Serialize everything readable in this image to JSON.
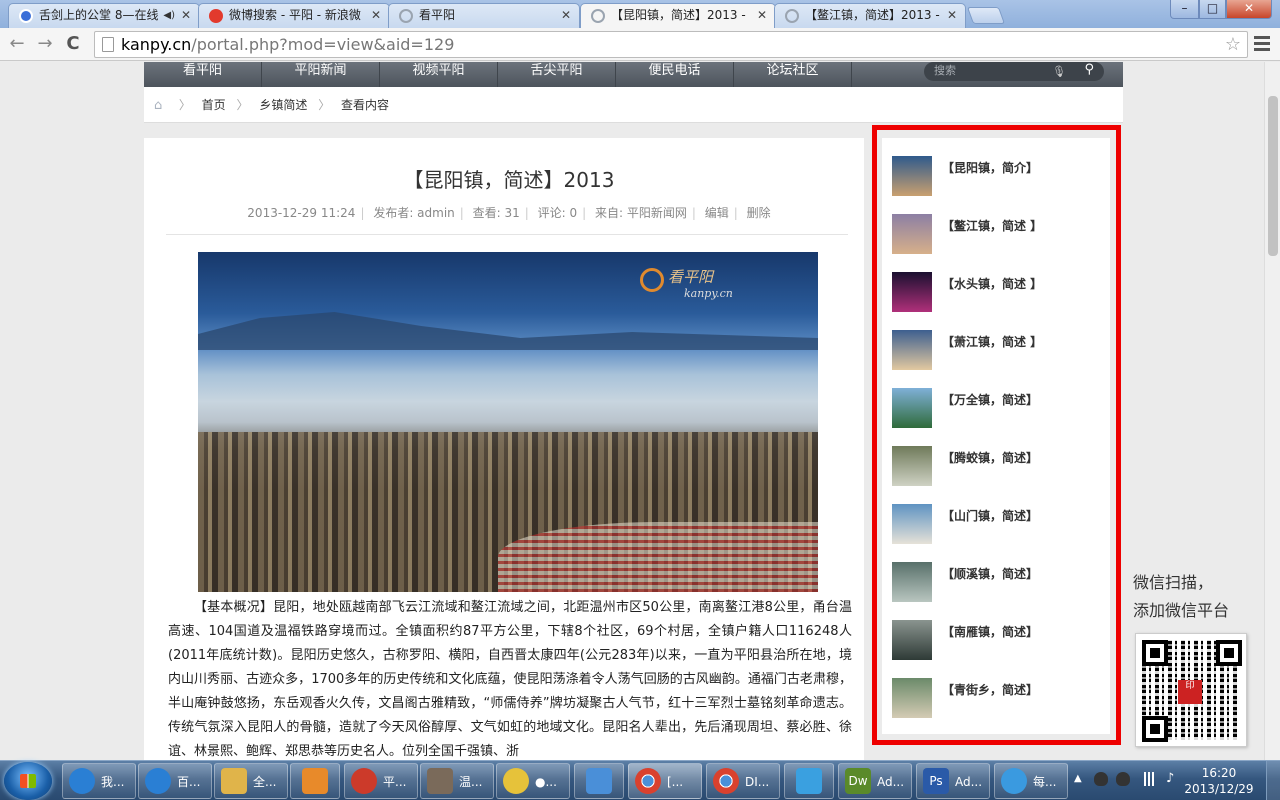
{
  "browser": {
    "tabs": [
      {
        "title": "舌剑上的公堂 8—在线",
        "favicon_color": "#3b6fd8",
        "has_sound": true
      },
      {
        "title": "微博搜索 - 平阳 - 新浪微",
        "favicon_color": "#e23a2d"
      },
      {
        "title": "看平阳",
        "favicon_color": "#9aa4b0"
      },
      {
        "title": "【昆阳镇，简述】2013 -",
        "favicon_color": "#9aa4b0",
        "active": true
      },
      {
        "title": "【鳌江镇，简述】2013 -",
        "favicon_color": "#9aa4b0"
      }
    ],
    "window_controls": {
      "min": "–",
      "max": "□",
      "close": "✕"
    },
    "url_domain": "kanpy.cn",
    "url_path": "/portal.php?mod=view&aid=129",
    "back": "←",
    "forward": "→",
    "reload": "C"
  },
  "site": {
    "nav": [
      "看平阳",
      "平阳新闻",
      "视频平阳",
      "舌尖平阳",
      "便民电话",
      "论坛社区"
    ],
    "search_placeholder": "搜索",
    "breadcrumbs": [
      "首页",
      "乡镇简述",
      "查看内容"
    ]
  },
  "article": {
    "title": "【昆阳镇，简述】2013",
    "meta": {
      "date": "2013-12-29 11:24",
      "publisher": "发布者: admin",
      "views": "查看: 31",
      "comments": "评论: 0",
      "source": "来自: 平阳新闻网",
      "edit": "编辑",
      "delete": "删除"
    },
    "photo_watermark": "看平阳",
    "photo_watermark_sub": "kanpy.cn",
    "body": "【基本概况】昆阳，地处瓯越南部飞云江流域和鳌江流域之间，北距温州市区50公里，南离鳌江港8公里，甬台温高速、104国道及温福铁路穿境而过。全镇面积约87平方公里，下辖8个社区，69个村居，全镇户籍人口116248人(2011年底统计数)。昆阳历史悠久，古称罗阳、横阳，自西晋太康四年(公元283年)以来，一直为平阳县治所在地，境内山川秀丽、古迹众多，1700多年的历史传统和文化底蕴，使昆阳荡涤着令人荡气回肠的古风幽韵。通福门古老肃穆，半山庵钟鼓悠扬，东岳观香火久传，文昌阁古雅精致，“师儒侍养”牌坊凝聚古人气节，红十三军烈士墓铭刻革命遗志。传统气氛深入昆阳人的骨髓，造就了今天风俗醇厚、文气如虹的地域文化。昆阳名人辈出，先后涌现周坦、蔡必胜、徐谊、林景熙、鲍辉、郑思恭等历史名人。位列全国千强镇、浙"
  },
  "sidebar": {
    "items": [
      {
        "label": "【昆阳镇，简介】",
        "thumb": [
          "#2f5a8c",
          "#c9a070"
        ]
      },
      {
        "label": "【鳌江镇，简述 】",
        "thumb": [
          "#8c7fa4",
          "#d7b08a"
        ]
      },
      {
        "label": "【水头镇，简述 】",
        "thumb": [
          "#1a1030",
          "#b0307a"
        ]
      },
      {
        "label": "【萧江镇，简述 】",
        "thumb": [
          "#3d5f8f",
          "#e2c9a0"
        ]
      },
      {
        "label": "【万全镇，简述】",
        "thumb": [
          "#7fb0d8",
          "#2f6b3a"
        ]
      },
      {
        "label": "【腾蛟镇，简述】",
        "thumb": [
          "#6f7a5a",
          "#cfd2c4"
        ]
      },
      {
        "label": "【山门镇，简述】",
        "thumb": [
          "#5f93c2",
          "#e6e2d8"
        ]
      },
      {
        "label": "【顺溪镇，简述】",
        "thumb": [
          "#58706a",
          "#b9c6c0"
        ]
      },
      {
        "label": "【南雁镇，简述】",
        "thumb": [
          "#8a948f",
          "#2e3a36"
        ]
      },
      {
        "label": "【青街乡，简述】",
        "thumb": [
          "#6b8a6a",
          "#d4cbb4"
        ]
      }
    ]
  },
  "wechat": {
    "line1": "微信扫描，",
    "line2": "添加微信平台"
  },
  "taskbar": {
    "buttons": [
      {
        "label": "我...",
        "icon_color": "#2a7fd4"
      },
      {
        "label": "百...",
        "icon_color": "#2a7fd4"
      },
      {
        "label": "全...",
        "icon_color": "#e0b44a"
      },
      {
        "label": "",
        "icon_color": "#e88a2a"
      },
      {
        "label": "平...",
        "icon_color": "#cc3a2a"
      },
      {
        "label": "温...",
        "icon_color": "#7a6a5a"
      },
      {
        "label": "●...",
        "icon_color": "#e6c23a"
      },
      {
        "label": "",
        "icon_color": "#4a8fd8"
      },
      {
        "label": "[...",
        "icon_color": "#d9412e"
      },
      {
        "label": "DI...",
        "icon_color": "#d9412e"
      },
      {
        "label": "",
        "icon_color": "#3aa0e0"
      },
      {
        "label": "Ad...",
        "icon_color": "#5a8a2a"
      },
      {
        "label": "Ad...",
        "icon_color": "#2a5aa8"
      },
      {
        "label": "每...",
        "icon_color": "#3a9ae0"
      }
    ],
    "time": "16:20",
    "date": "2013/12/29"
  }
}
